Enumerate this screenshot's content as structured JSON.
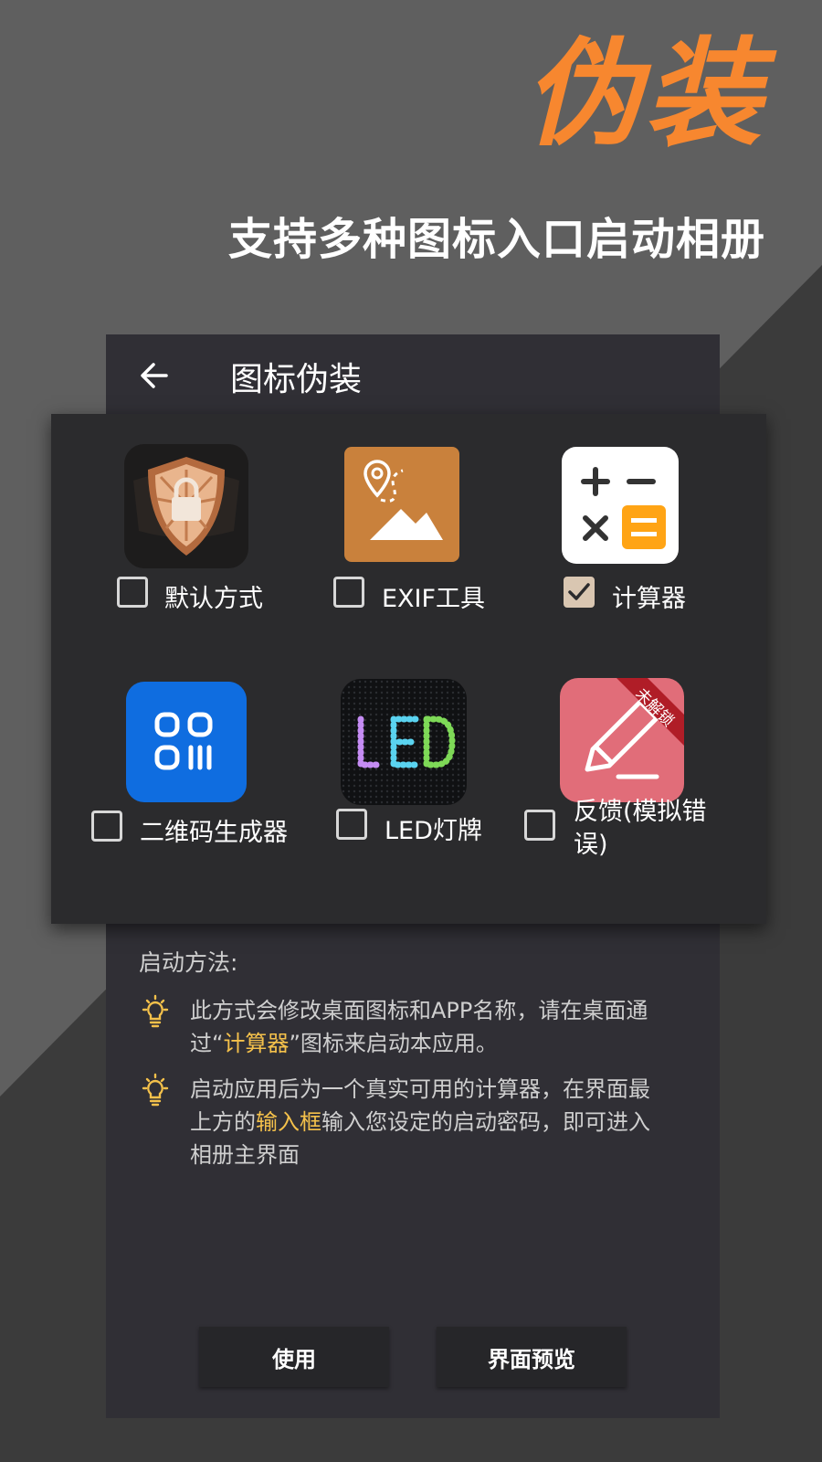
{
  "promo": {
    "headline": "伪装",
    "subline": "支持多种图标入口启动相册"
  },
  "header": {
    "title": "图标伪装"
  },
  "options": [
    {
      "label": "默认方式",
      "checked": false,
      "icon": "shield-lock-icon"
    },
    {
      "label": "EXIF工具",
      "checked": false,
      "icon": "map-photo-icon"
    },
    {
      "label": "计算器",
      "checked": true,
      "icon": "calculator-icon"
    },
    {
      "label": "二维码生成器",
      "checked": false,
      "icon": "qr-code-icon"
    },
    {
      "label": "LED灯牌",
      "checked": false,
      "icon": "led-sign-icon"
    },
    {
      "label": "反馈(模拟错误)",
      "checked": false,
      "icon": "pencil-edit-icon",
      "ribbon": "未解锁"
    }
  ],
  "method": {
    "title": "启动方法:",
    "tip1": {
      "a": "此方式会修改桌面图标和APP名称，请在桌面通过“",
      "highlight": "计算器",
      "b": "”图标来启动本应用。"
    },
    "tip2": {
      "a": "启动应用后为一个真实可用的计算器，在界面最上方的",
      "highlight": "输入框",
      "b": "输入您设定的启动密码，即可进入相册主界面"
    }
  },
  "buttons": {
    "use": "使用",
    "preview": "界面预览"
  },
  "colors": {
    "accent": "#f7872f",
    "highlight": "#f4c14b",
    "checked": "#d9c6b1"
  }
}
